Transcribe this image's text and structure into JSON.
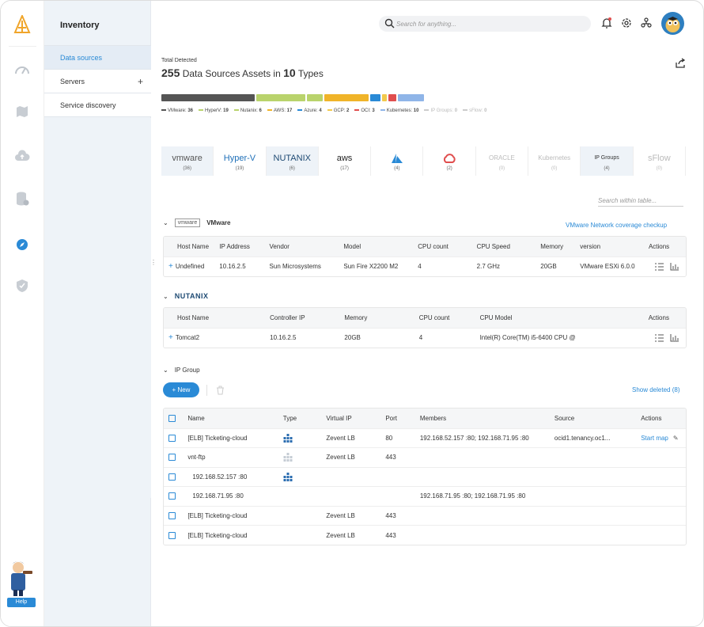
{
  "sidebar": {
    "title": "Inventory",
    "items": [
      {
        "label": "Data sources",
        "active": true
      },
      {
        "label": "Servers",
        "has_add": true
      },
      {
        "label": "Service discovery"
      }
    ],
    "help_label": "Help"
  },
  "header": {
    "search_placeholder": "Search for anything..."
  },
  "summary": {
    "label": "Total Detected",
    "count": "255",
    "mid_text": "Data Sources Assets in",
    "types": "10",
    "types_suffix": "Types"
  },
  "distribution": [
    {
      "name": "VMware",
      "value": 36,
      "color": "#555555"
    },
    {
      "name": "HyperV",
      "value": 19,
      "color": "#b9d36c"
    },
    {
      "name": "Nutanix",
      "value": 6,
      "color": "#b9d36c"
    },
    {
      "name": "AWS",
      "value": 17,
      "color": "#f0b429"
    },
    {
      "name": "Azure",
      "value": 4,
      "color": "#2a8ad6"
    },
    {
      "name": "GCP",
      "value": 2,
      "color": "#f2c94c"
    },
    {
      "name": "OCI",
      "value": 3,
      "color": "#e04e4e"
    },
    {
      "name": "Kubernetes",
      "value": 10,
      "color": "#8fb5e8"
    },
    {
      "name": "IP Groups",
      "value": 0,
      "color": "#cccccc"
    },
    {
      "name": "sFlow",
      "value": 0,
      "color": "#cccccc"
    }
  ],
  "tiles": [
    {
      "label": "vmware",
      "count": "(36)",
      "selected": true
    },
    {
      "label": "Hyper-V",
      "count": "(19)"
    },
    {
      "label": "NUTANIX",
      "count": "(6)",
      "selected": true
    },
    {
      "label": "aws",
      "count": "(17)"
    },
    {
      "label": "",
      "count": "(4)"
    },
    {
      "label": "",
      "count": "(2)"
    },
    {
      "label": "ORACLE",
      "count": "(0)",
      "dim": true
    },
    {
      "label": "Kubernetes",
      "count": "(0)",
      "dim": true
    },
    {
      "label": "IP Groups",
      "count": "(4)",
      "selected": true
    },
    {
      "label": "sFlow",
      "count": "(0)",
      "dim": true
    }
  ],
  "table_search_placeholder": "Search within table...",
  "vmware": {
    "logo": "vmware",
    "title": "VMware",
    "link": "VMware Network coverage checkup",
    "columns": [
      "Host Name",
      "IP Address",
      "Vendor",
      "Model",
      "CPU count",
      "CPU Speed",
      "Memory",
      "version",
      "Actions"
    ],
    "rows": [
      [
        "Undefined",
        "10.16.2.5",
        "Sun Microsystems",
        "Sun Fire X2200 M2",
        "4",
        "2.7 GHz",
        "20GB",
        "VMware ESXi 6.0.0"
      ]
    ]
  },
  "nutanix": {
    "logo": "NUTANIX",
    "columns": [
      "Host Name",
      "Controller IP",
      "Memory",
      "CPU count",
      "CPU Model",
      "Actions"
    ],
    "rows": [
      [
        "Tomcat2",
        "10.16.2.5",
        "20GB",
        "4",
        "Intel(R) Core(TM) i5-6400 CPU @"
      ]
    ]
  },
  "ipgroup": {
    "title": "IP Group",
    "new_label": "New",
    "show_deleted": "Show deleted (8)",
    "start_map": "Start map",
    "columns": [
      "Name",
      "Type",
      "Virtual IP",
      "Port",
      "Members",
      "Source",
      "Actions"
    ],
    "rows": [
      [
        "[ELB] Ticketing-cloud",
        "Zevent LB",
        "80",
        "192.168.52.157 :80; 192.168.71.95 :80",
        "ocid1.tenancy.oc1..."
      ],
      [
        "vnt-ftp",
        "Zevent LB",
        "443",
        "",
        ""
      ],
      [
        "192.168.52.157 :80",
        "",
        "",
        "",
        ""
      ],
      [
        "192.168.71.95 :80",
        "",
        "",
        "192.168.71.95 :80; 192.168.71.95 :80",
        ""
      ],
      [
        "[ELB] Ticketing-cloud",
        "Zevent LB",
        "443",
        "",
        ""
      ],
      [
        "[ELB] Ticketing-cloud",
        "Zevent LB",
        "443",
        "",
        ""
      ]
    ]
  }
}
